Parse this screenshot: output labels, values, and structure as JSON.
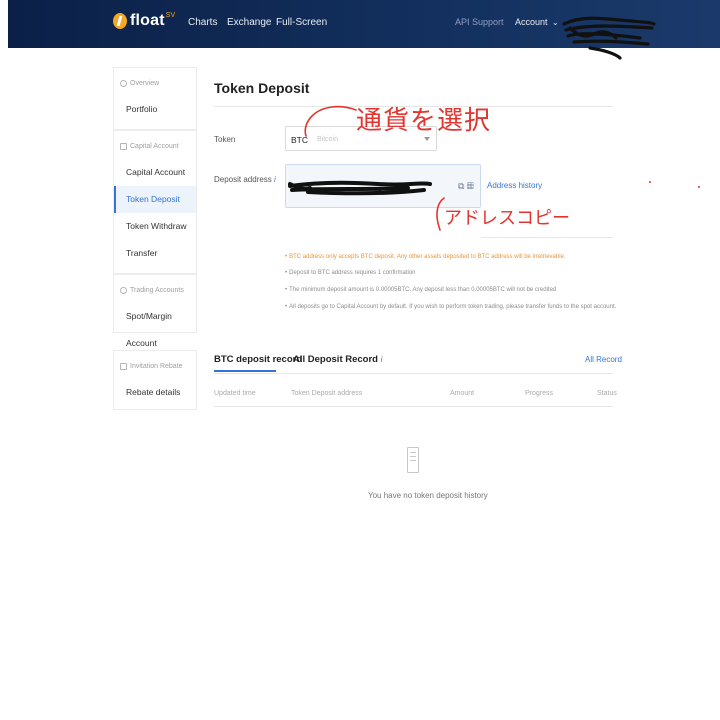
{
  "header": {
    "brand": "float",
    "brand_sup": "SV",
    "nav": [
      "Charts",
      "Exchange",
      "Full-Screen"
    ],
    "right_links": [
      "API",
      "Support"
    ],
    "account": "Account",
    "account_caret": "⌄"
  },
  "sidebar": {
    "overview": {
      "heading": "Overview",
      "items": [
        "Portfolio"
      ]
    },
    "capital": {
      "heading": "Capital Account",
      "items": [
        "Capital Account",
        "Token Deposit",
        "Token Withdraw",
        "Transfer"
      ],
      "active": "Token Deposit"
    },
    "trading": {
      "heading": "Trading Accounts",
      "items": [
        "Spot/Margin Account"
      ]
    },
    "invitation": {
      "heading": "Invitation Rebate",
      "items": [
        "Rebate details"
      ]
    }
  },
  "main": {
    "title": "Token Deposit",
    "token_label": "Token",
    "token_code": "BTC",
    "token_name": "Bitcoin",
    "deposit_address_label": "Deposit address",
    "info_icon": "i",
    "copy_icons": "⧉ ▦",
    "address_history": "Address history",
    "notes": [
      "BTC address only accepts BTC deposit. Any other assets deposited to BTC address will be irretrievable.",
      "Deposit to BTC address requires 1 confirmation",
      "The minimum deposit amount is 0.00005BTC. Any deposit less than 0.00005BTC will not be credited",
      "All deposits go to Capital Account by default. If you wish to perform token trading, please transfer funds to the spot account."
    ]
  },
  "records": {
    "tabs": [
      "BTC deposit record",
      "All Deposit Record"
    ],
    "all_record": "All Record",
    "columns": [
      "Updated time",
      "Token Deposit address",
      "Amount",
      "Progress",
      "Status"
    ],
    "empty_text": "You have no token deposit history"
  },
  "annotations": {
    "select_currency": "通貨を選択",
    "copy_address": "アドレスコピー"
  },
  "colors": {
    "nav_bg": "#0b2047",
    "accent": "#3574d4",
    "brand_orange": "#f5a623",
    "warning": "#e8953a",
    "annotation_red": "#e3342f"
  }
}
